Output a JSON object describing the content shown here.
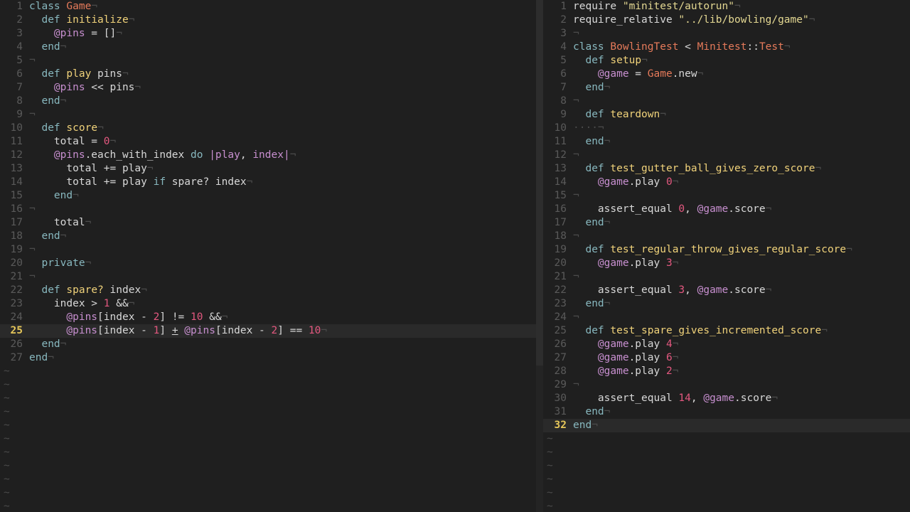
{
  "colors": {
    "background": "#1f1f1f",
    "current_line": "#2a2a2a",
    "line_number": "#5a5a5a",
    "current_line_number": "#e6c75a",
    "keyword": "#88b8bf",
    "method_name": "#f0d27a",
    "class_name": "#e57a5a",
    "instance_variable": "#c78fcf",
    "number": "#e3587f",
    "string": "#e4d892",
    "eol_marker": "#4b4b4b"
  },
  "eol_marker": "¬",
  "empty_line_marker": "~",
  "left_pane": {
    "current_line": 25,
    "empty_rows": 11,
    "lines": [
      [
        [
          "kw",
          "class"
        ],
        [
          "t",
          " "
        ],
        [
          "cls",
          "Game"
        ]
      ],
      [
        [
          "t",
          "  "
        ],
        [
          "kw",
          "def"
        ],
        [
          "t",
          " "
        ],
        [
          "fn",
          "initialize"
        ]
      ],
      [
        [
          "t",
          "    "
        ],
        [
          "ivar",
          "@pins"
        ],
        [
          "t",
          " = []"
        ]
      ],
      [
        [
          "t",
          "  "
        ],
        [
          "kw",
          "end"
        ]
      ],
      [],
      [
        [
          "t",
          "  "
        ],
        [
          "kw",
          "def"
        ],
        [
          "t",
          " "
        ],
        [
          "fn",
          "play"
        ],
        [
          "t",
          " pins"
        ]
      ],
      [
        [
          "t",
          "    "
        ],
        [
          "ivar",
          "@pins"
        ],
        [
          "t",
          " << pins"
        ]
      ],
      [
        [
          "t",
          "  "
        ],
        [
          "kw",
          "end"
        ]
      ],
      [],
      [
        [
          "t",
          "  "
        ],
        [
          "kw",
          "def"
        ],
        [
          "t",
          " "
        ],
        [
          "fn",
          "score"
        ]
      ],
      [
        [
          "t",
          "    total = "
        ],
        [
          "num",
          "0"
        ]
      ],
      [
        [
          "t",
          "    "
        ],
        [
          "ivar",
          "@pins"
        ],
        [
          "t",
          ".each_with_index "
        ],
        [
          "kw",
          "do"
        ],
        [
          "t",
          " "
        ],
        [
          "pipe",
          "|"
        ],
        [
          "ivar",
          "play"
        ],
        [
          "t",
          ", "
        ],
        [
          "ivar",
          "index"
        ],
        [
          "pipe",
          "|"
        ]
      ],
      [
        [
          "t",
          "      total += play"
        ]
      ],
      [
        [
          "t",
          "      total += play "
        ],
        [
          "kw",
          "if"
        ],
        [
          "t",
          " spare? index"
        ]
      ],
      [
        [
          "t",
          "    "
        ],
        [
          "kw",
          "end"
        ]
      ],
      [],
      [
        [
          "t",
          "    total"
        ]
      ],
      [
        [
          "t",
          "  "
        ],
        [
          "kw",
          "end"
        ]
      ],
      [],
      [
        [
          "t",
          "  "
        ],
        [
          "kw",
          "private"
        ]
      ],
      [],
      [
        [
          "t",
          "  "
        ],
        [
          "kw",
          "def"
        ],
        [
          "t",
          " "
        ],
        [
          "fn",
          "spare?"
        ],
        [
          "t",
          " index"
        ]
      ],
      [
        [
          "t",
          "    index > "
        ],
        [
          "num",
          "1"
        ],
        [
          "t",
          " &&"
        ]
      ],
      [
        [
          "t",
          "      "
        ],
        [
          "ivar",
          "@pins"
        ],
        [
          "t",
          "[index - "
        ],
        [
          "num",
          "2"
        ],
        [
          "t",
          "] != "
        ],
        [
          "num",
          "10"
        ],
        [
          "t",
          " &&"
        ]
      ],
      [
        [
          "t",
          "      "
        ],
        [
          "ivar",
          "@pins"
        ],
        [
          "t",
          "[index - "
        ],
        [
          "num",
          "1"
        ],
        [
          "t",
          "] "
        ],
        [
          "ul",
          "+"
        ],
        [
          "t",
          " "
        ],
        [
          "ivar",
          "@pins"
        ],
        [
          "t",
          "[index - "
        ],
        [
          "num",
          "2"
        ],
        [
          "t",
          "] == "
        ],
        [
          "num",
          "10"
        ]
      ],
      [
        [
          "t",
          "  "
        ],
        [
          "kw",
          "end"
        ]
      ],
      [
        [
          "kw",
          "end"
        ]
      ]
    ]
  },
  "right_pane": {
    "current_line": 32,
    "empty_rows": 6,
    "lines": [
      [
        [
          "t",
          "require "
        ],
        [
          "str",
          "\"minitest/autorun\""
        ]
      ],
      [
        [
          "t",
          "require_relative "
        ],
        [
          "str",
          "\"../lib/bowling/game\""
        ]
      ],
      [],
      [
        [
          "kw",
          "class"
        ],
        [
          "t",
          " "
        ],
        [
          "cls",
          "BowlingTest"
        ],
        [
          "t",
          " < "
        ],
        [
          "cls",
          "Minitest"
        ],
        [
          "t",
          "::"
        ],
        [
          "cls",
          "Test"
        ]
      ],
      [
        [
          "t",
          "  "
        ],
        [
          "kw",
          "def"
        ],
        [
          "t",
          " "
        ],
        [
          "fn",
          "setup"
        ]
      ],
      [
        [
          "t",
          "    "
        ],
        [
          "ivar",
          "@game"
        ],
        [
          "t",
          " = "
        ],
        [
          "cls",
          "Game"
        ],
        [
          "t",
          ".new"
        ]
      ],
      [
        [
          "t",
          "  "
        ],
        [
          "kw",
          "end"
        ]
      ],
      [],
      [
        [
          "t",
          "  "
        ],
        [
          "kw",
          "def"
        ],
        [
          "t",
          " "
        ],
        [
          "fn",
          "teardown"
        ]
      ],
      [
        [
          "ws",
          "····"
        ]
      ],
      [
        [
          "t",
          "  "
        ],
        [
          "kw",
          "end"
        ]
      ],
      [],
      [
        [
          "t",
          "  "
        ],
        [
          "kw",
          "def"
        ],
        [
          "t",
          " "
        ],
        [
          "fn",
          "test_gutter_ball_gives_zero_score"
        ]
      ],
      [
        [
          "t",
          "    "
        ],
        [
          "ivar",
          "@game"
        ],
        [
          "t",
          ".play "
        ],
        [
          "num",
          "0"
        ]
      ],
      [],
      [
        [
          "t",
          "    assert_equal "
        ],
        [
          "num",
          "0"
        ],
        [
          "t",
          ", "
        ],
        [
          "ivar",
          "@game"
        ],
        [
          "t",
          ".score"
        ]
      ],
      [
        [
          "t",
          "  "
        ],
        [
          "kw",
          "end"
        ]
      ],
      [],
      [
        [
          "t",
          "  "
        ],
        [
          "kw",
          "def"
        ],
        [
          "t",
          " "
        ],
        [
          "fn",
          "test_regular_throw_gives_regular_score"
        ]
      ],
      [
        [
          "t",
          "    "
        ],
        [
          "ivar",
          "@game"
        ],
        [
          "t",
          ".play "
        ],
        [
          "num",
          "3"
        ]
      ],
      [],
      [
        [
          "t",
          "    assert_equal "
        ],
        [
          "num",
          "3"
        ],
        [
          "t",
          ", "
        ],
        [
          "ivar",
          "@game"
        ],
        [
          "t",
          ".score"
        ]
      ],
      [
        [
          "t",
          "  "
        ],
        [
          "kw",
          "end"
        ]
      ],
      [],
      [
        [
          "t",
          "  "
        ],
        [
          "kw",
          "def"
        ],
        [
          "t",
          " "
        ],
        [
          "fn",
          "test_spare_gives_incremented_score"
        ]
      ],
      [
        [
          "t",
          "    "
        ],
        [
          "ivar",
          "@game"
        ],
        [
          "t",
          ".play "
        ],
        [
          "num",
          "4"
        ]
      ],
      [
        [
          "t",
          "    "
        ],
        [
          "ivar",
          "@game"
        ],
        [
          "t",
          ".play "
        ],
        [
          "num",
          "6"
        ]
      ],
      [
        [
          "t",
          "    "
        ],
        [
          "ivar",
          "@game"
        ],
        [
          "t",
          ".play "
        ],
        [
          "num",
          "2"
        ]
      ],
      [],
      [
        [
          "t",
          "    assert_equal "
        ],
        [
          "num",
          "14"
        ],
        [
          "t",
          ", "
        ],
        [
          "ivar",
          "@game"
        ],
        [
          "t",
          ".score"
        ]
      ],
      [
        [
          "t",
          "  "
        ],
        [
          "kw",
          "end"
        ]
      ],
      [
        [
          "kw",
          "end"
        ]
      ]
    ]
  }
}
